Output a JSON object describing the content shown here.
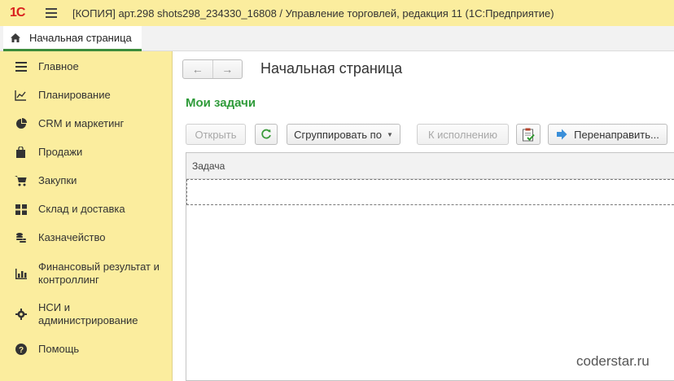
{
  "titlebar": {
    "logo": "1С",
    "title": "[КОПИЯ] арт.298 shots298_234330_16808 / Управление торговлей, редакция 11  (1С:Предприятие)"
  },
  "tabs": {
    "home_label": "Начальная страница"
  },
  "sidebar": {
    "items": [
      {
        "label": "Главное",
        "icon": "menu-lines-icon"
      },
      {
        "label": "Планирование",
        "icon": "chart-line-icon"
      },
      {
        "label": "CRM и маркетинг",
        "icon": "pie-chart-icon"
      },
      {
        "label": "Продажи",
        "icon": "shopping-bag-icon"
      },
      {
        "label": "Закупки",
        "icon": "cart-icon"
      },
      {
        "label": "Склад и доставка",
        "icon": "grid-blocks-icon"
      },
      {
        "label": "Казначейство",
        "icon": "coins-icon"
      },
      {
        "label": "Финансовый результат и контроллинг",
        "icon": "bar-chart-icon"
      },
      {
        "label": "НСИ и администрирование",
        "icon": "gear-icon"
      },
      {
        "label": "Помощь",
        "icon": "help-icon"
      }
    ]
  },
  "main": {
    "page_title": "Начальная страница",
    "section_title": "Мои задачи",
    "toolbar": {
      "open_label": "Открыть",
      "group_label": "Сгруппировать по",
      "execute_label": "К исполнению",
      "redirect_label": "Перенаправить..."
    },
    "table": {
      "columns": [
        "Задача"
      ]
    }
  },
  "watermark": "coderstar.ru",
  "colors": {
    "accent_yellow": "#fbed9e",
    "section_green": "#2f9b3a",
    "logo_red": "#d9201e"
  }
}
